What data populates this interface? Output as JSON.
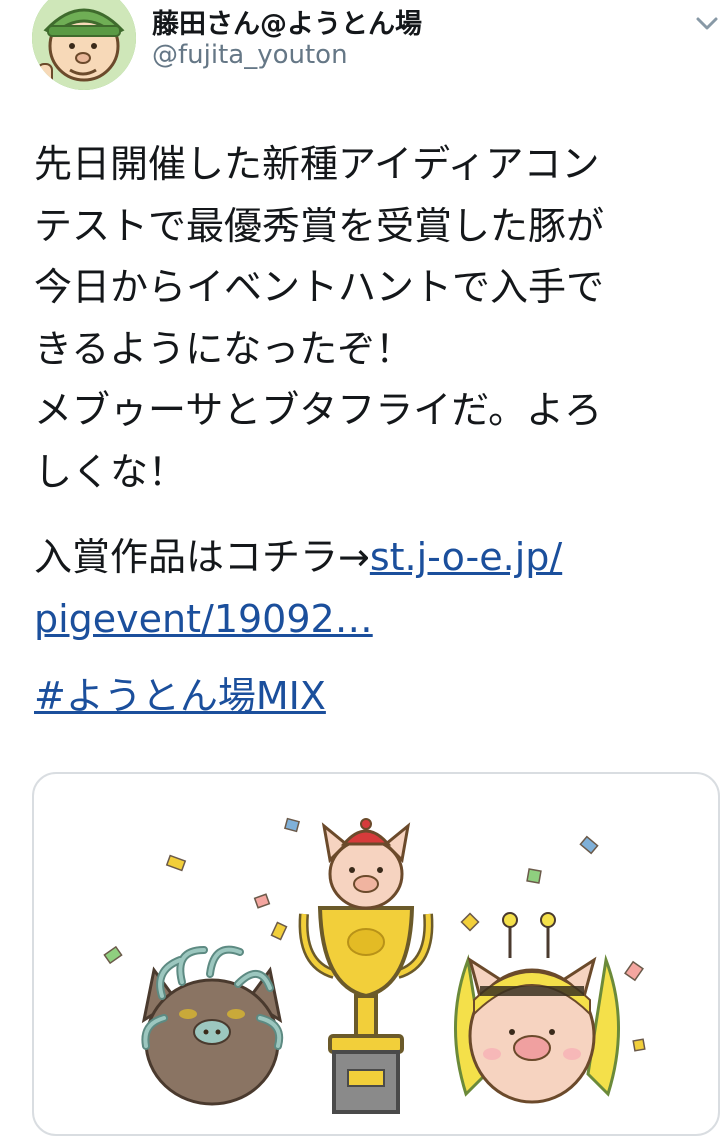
{
  "author": {
    "display_name": "藤田さん@ようとん場",
    "handle": "@fujita_youton",
    "avatar_icon": "farmer-avatar-icon"
  },
  "menu": {
    "icon": "chevron-down-icon"
  },
  "tweet": {
    "lines": [
      "先日開催した新種アイディアコン",
      "テストで最優秀賞を受賞した豚が",
      "今日からイベントハントで入手で",
      "きるようになったぞ！",
      "メブゥーサとブタフライだ。よろ",
      "しくな！"
    ],
    "link_prefix": "入賞作品はコチラ→",
    "link_part1": "st.j-o-e.jp/",
    "link_part2": "pigevent/19092…",
    "hashtag": "#ようとん場MIX"
  },
  "media": {
    "description_icon": "contest-winners-illustration",
    "colors": {
      "trophy": "#f2cf3a",
      "trophy_outline": "#6b5a2a",
      "pig_skin": "#f6d3c0",
      "medusa_skin": "#8a7463",
      "snake_hair": "#7aa9a0",
      "bee_stripe": "#f4e04a"
    }
  },
  "colors": {
    "text": "#14171a",
    "secondary": "#657786",
    "link": "#1b4f9c",
    "border": "#d9dde1"
  }
}
